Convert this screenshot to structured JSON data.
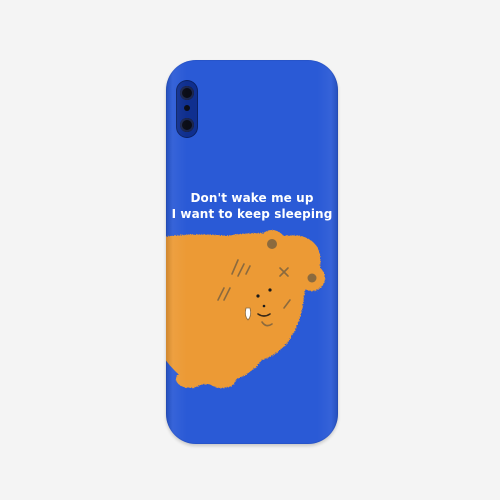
{
  "case": {
    "color": "#2a5ad6",
    "camera_color": "#0f2f8f"
  },
  "caption": {
    "line1": "Don't wake me up",
    "line2": "I want to keep sleeping"
  },
  "illustration": {
    "subject": "sleeping-orange-bear",
    "fur_color": "#ec9a35",
    "detail_color": "#8b6a3e"
  }
}
